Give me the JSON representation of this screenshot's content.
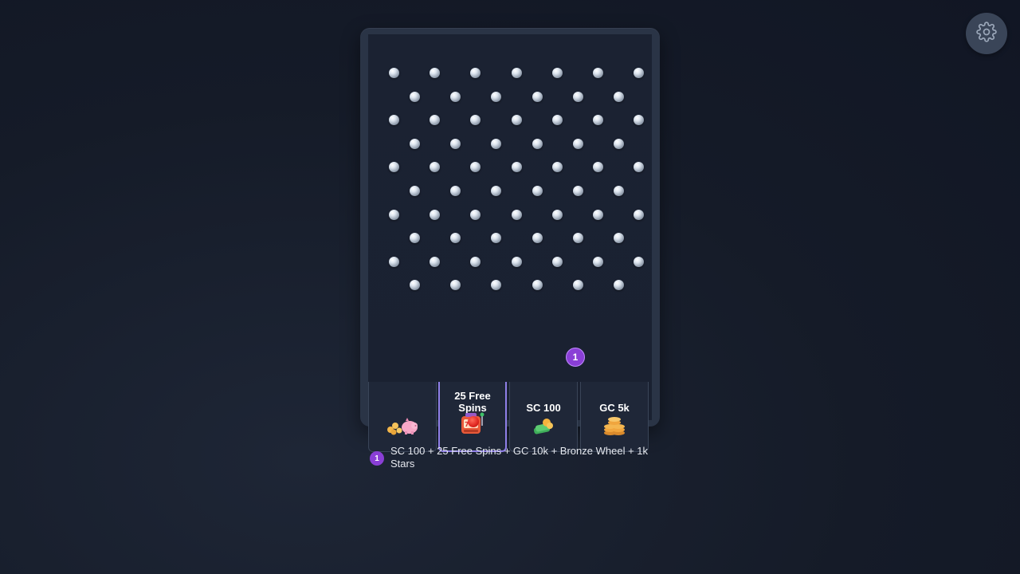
{
  "settings": {
    "icon": "gear-icon"
  },
  "slots": [
    {
      "label": "",
      "icon": "coins-piggy-icon"
    },
    {
      "label": "25 Free Spins",
      "icon": "slot-machine-icon",
      "active": true
    },
    {
      "label": "SC 100",
      "icon": "cash-stack-icon"
    },
    {
      "label": "GC 5k",
      "icon": "coin-stack-icon"
    }
  ],
  "badge": {
    "number": "1"
  },
  "legend": {
    "number": "1",
    "text": "SC 100 + 25 Free Spins + GC 10k + Bronze Wheel + 1k Stars"
  },
  "colors": {
    "accent": "#8a3fd6",
    "active_slot_border": "#8f7fe8",
    "ball": "#e0261f"
  }
}
